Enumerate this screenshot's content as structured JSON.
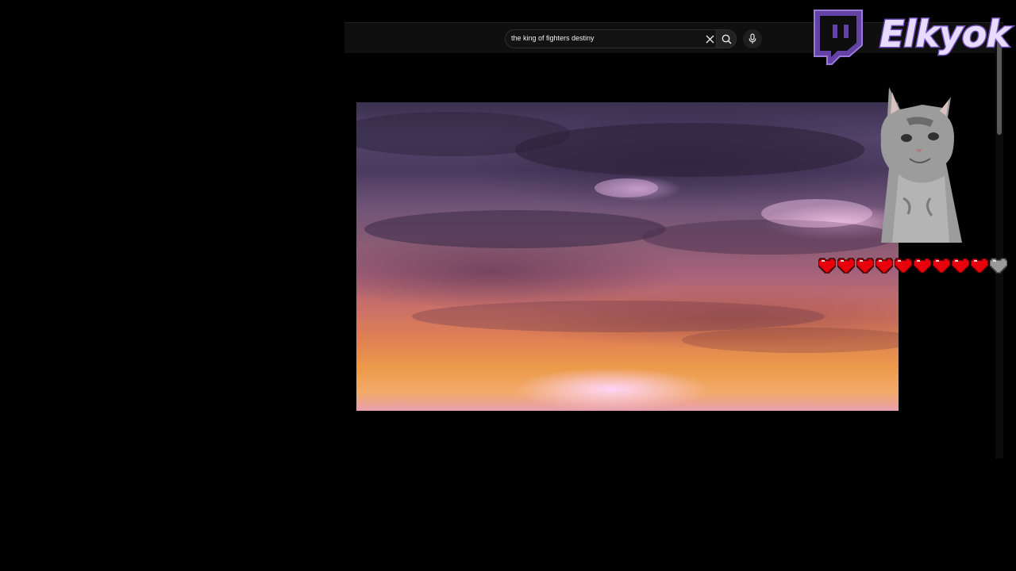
{
  "search": {
    "query": "the king of fighters destiny"
  },
  "overlay": {
    "channel_name": "Elkyok",
    "hearts": {
      "filled": 9,
      "total": 10
    }
  },
  "colors": {
    "twitch_purple": "#6441a5",
    "heart_red": "#e8000c",
    "heart_empty": "#9a9a9a"
  },
  "icons": [
    "close-icon",
    "search-icon",
    "microphone-icon",
    "twitch-icon",
    "heart-icon"
  ]
}
